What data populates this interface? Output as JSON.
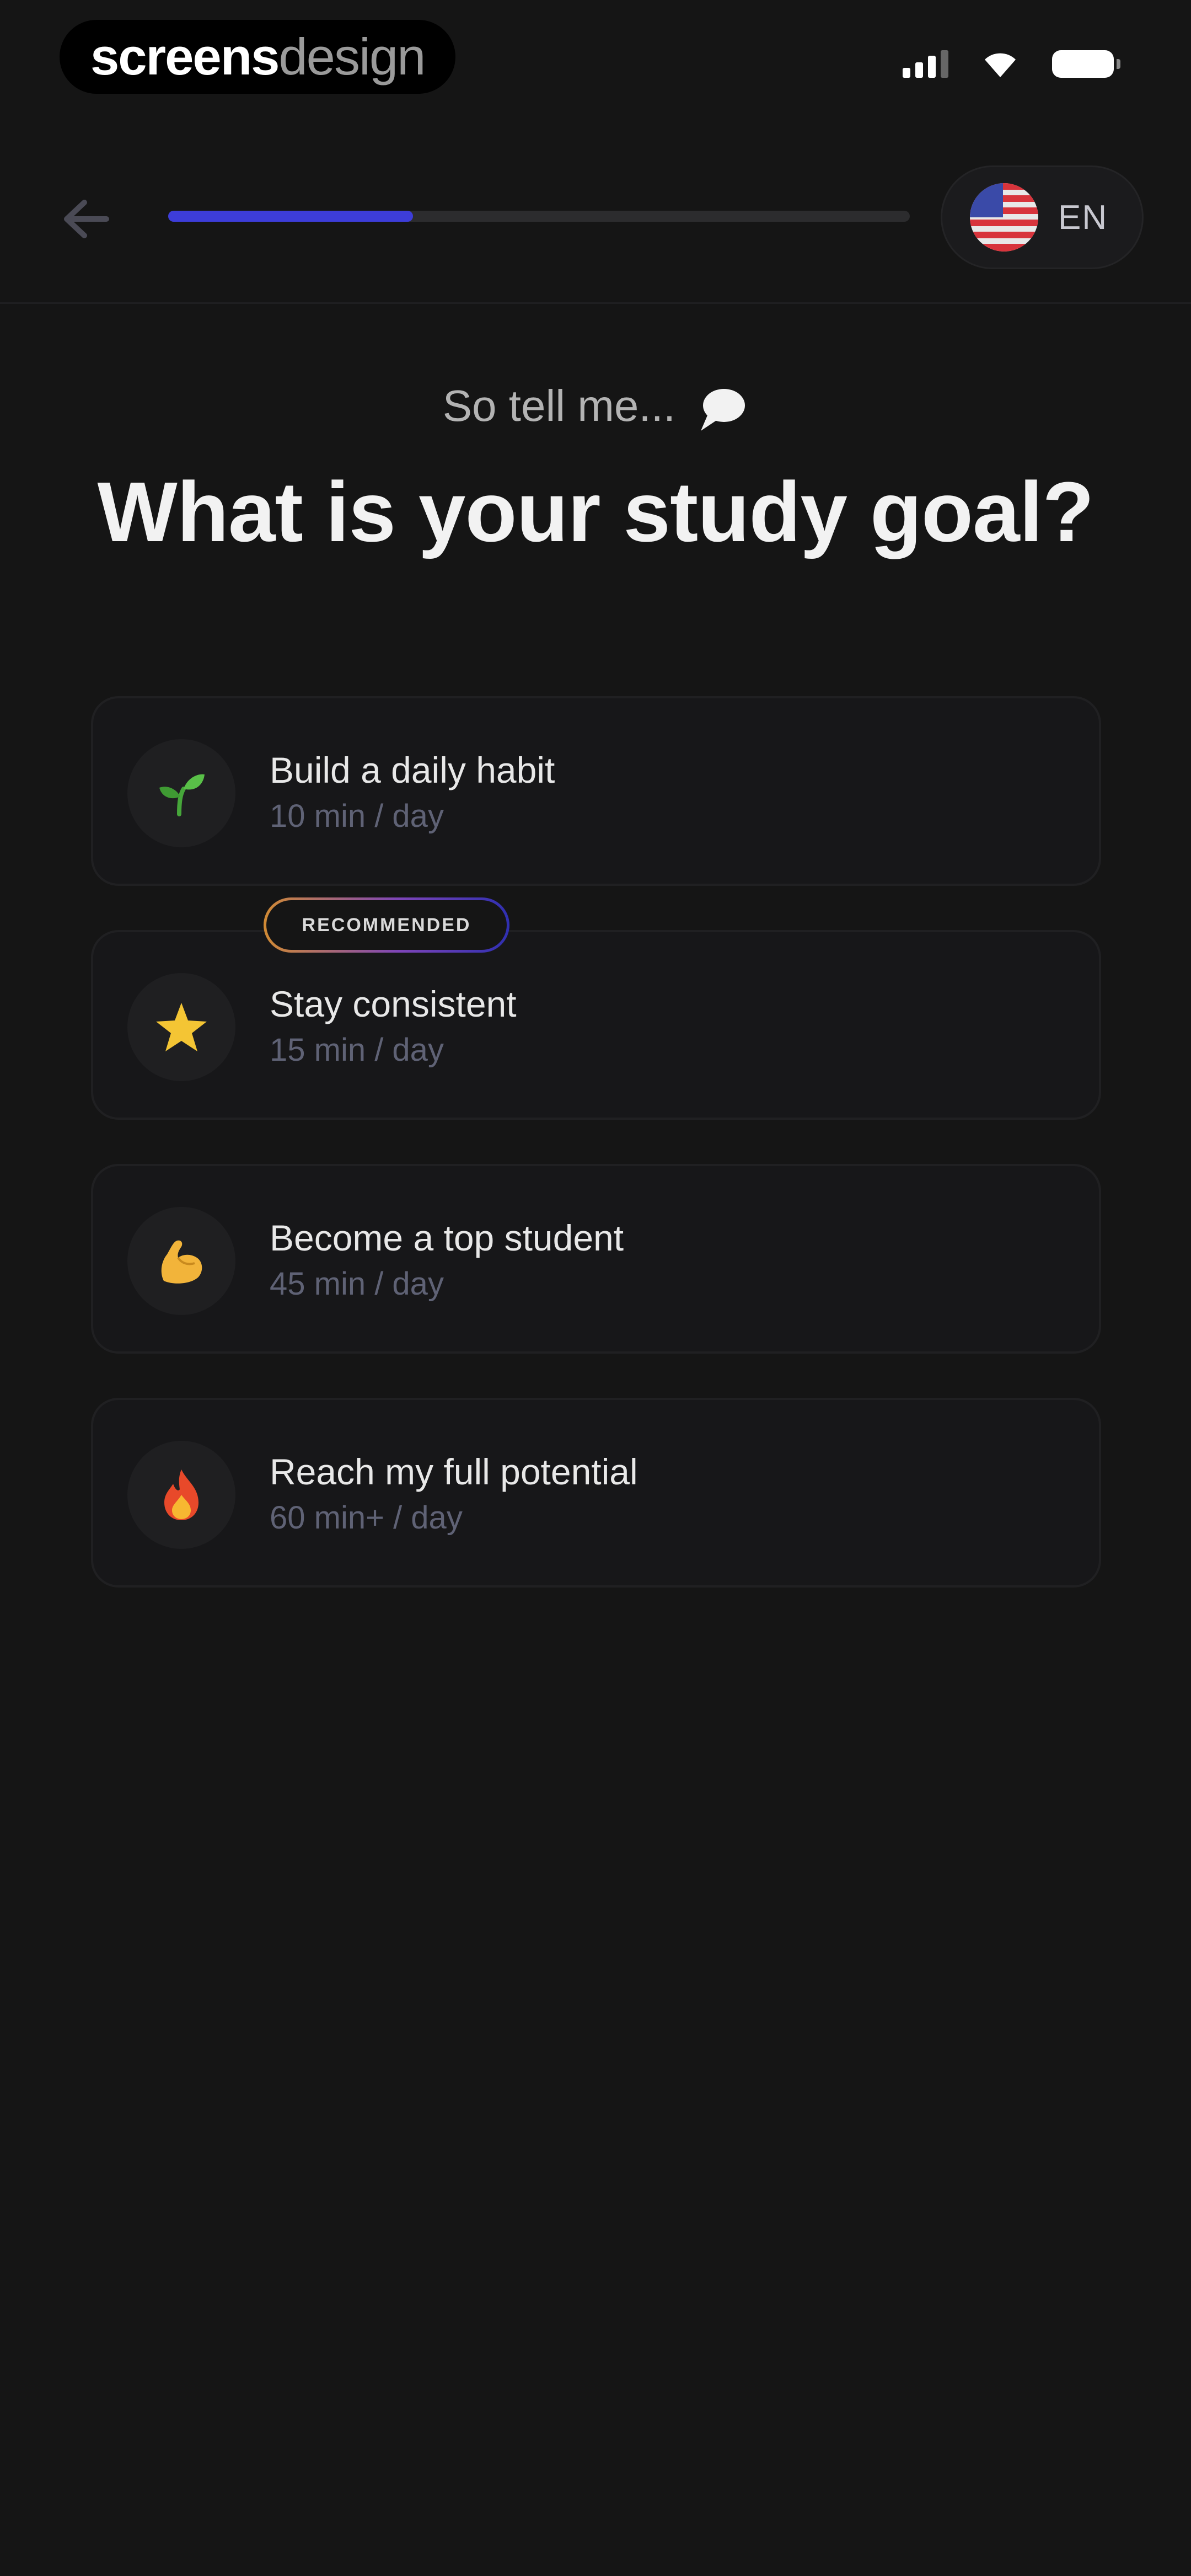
{
  "watermark": {
    "bold": "screens",
    "light": "design"
  },
  "header": {
    "progress_percent": 33,
    "language": {
      "code": "EN",
      "flag_icon": "us-flag-icon"
    }
  },
  "question": {
    "eyebrow": "So tell me...",
    "eyebrow_icon": "speech-bubble-icon",
    "title": "What is your study goal?"
  },
  "options": [
    {
      "title": "Build a daily habit",
      "subtitle": "10 min / day",
      "icon": "seedling-icon"
    },
    {
      "title": "Stay consistent",
      "subtitle": "15 min / day",
      "icon": "star-icon",
      "badge": "RECOMMENDED"
    },
    {
      "title": "Become a top student",
      "subtitle": "45 min / day",
      "icon": "flexed-biceps-icon"
    },
    {
      "title": "Reach my full potential",
      "subtitle": "60 min+ / day",
      "icon": "fire-icon"
    }
  ],
  "colors": {
    "background": "#151515",
    "accent": "#3d3dd9",
    "card_background": "#171719",
    "subtitle": "#5f6275"
  }
}
